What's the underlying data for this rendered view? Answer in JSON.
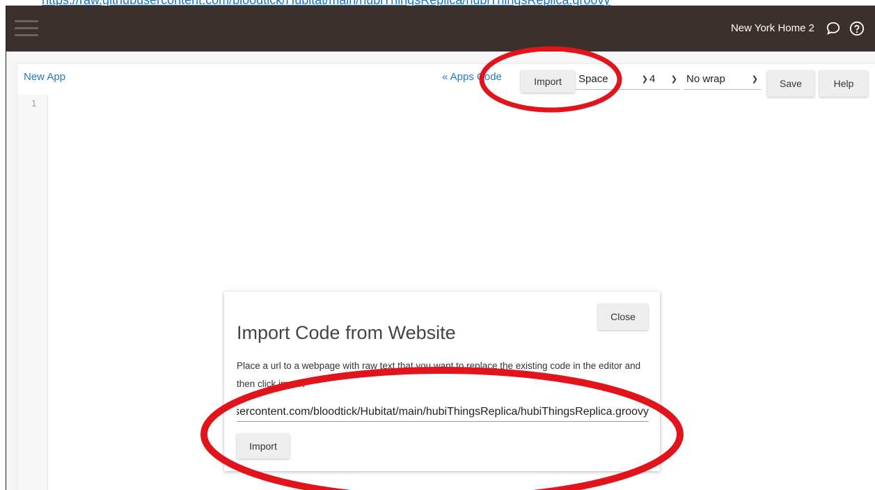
{
  "top_link": {
    "text": "https://raw.githubusercontent.com/bloodtick/Hubitat/main/hubiThingsReplica/hubiThingsReplica.groovy"
  },
  "header": {
    "home_name": "New York Home 2",
    "icons": [
      "hamburger-menu-icon",
      "chat-bubble-icon",
      "help-circle-icon"
    ],
    "background": "#3b302c"
  },
  "editor": {
    "app_title": "New App",
    "apps_code_link": "« Apps Code",
    "import_label": "Import",
    "indent_type": "Space",
    "indent_size": "4",
    "wrap_mode": "No wrap",
    "save_label": "Save",
    "help_label": "Help",
    "line_numbers": [
      "1"
    ],
    "link_color": "#1e7bc6"
  },
  "dialog": {
    "close_label": "Close",
    "title": "Import Code from Website",
    "description": "Place a url to a webpage with raw text that you want to replace the existing code in the editor and then click import",
    "url_value": "https://raw.githubusercontent.com/bloodtick/Hubitat/main/hubiThingsReplica/hubiThingsReplica.groovy",
    "import_label": "Import"
  },
  "annotations": {
    "color": "#e0141a"
  }
}
